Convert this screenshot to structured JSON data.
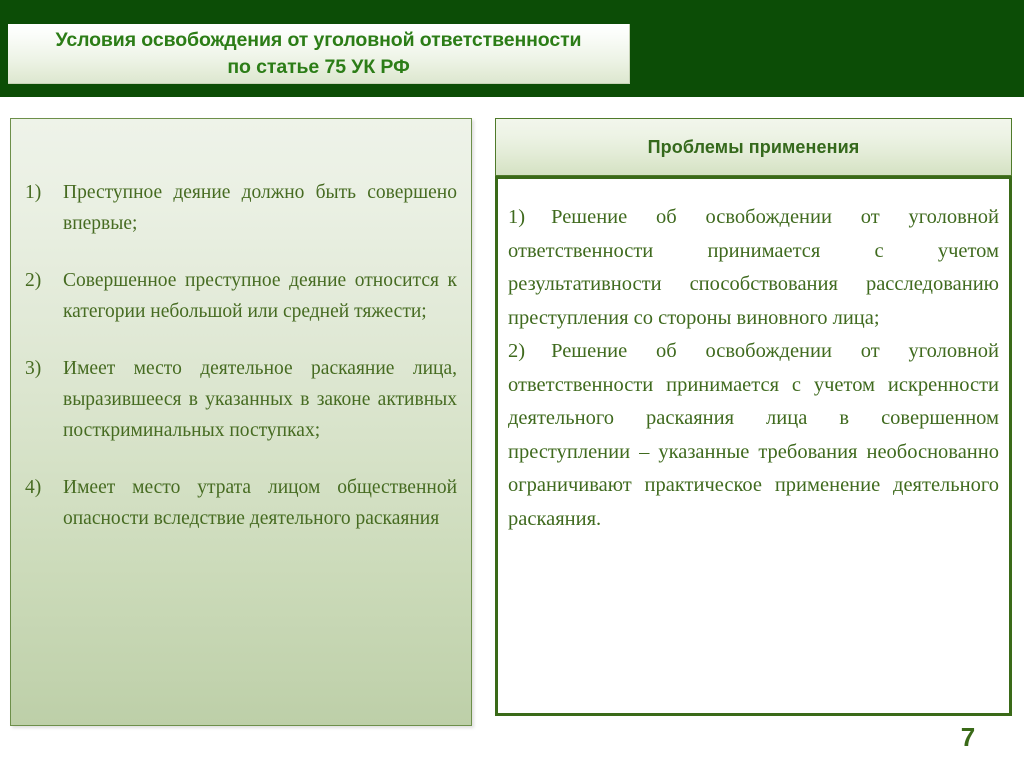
{
  "slide": {
    "page_number": "7",
    "banner_color": "#0c4d06",
    "accent_color": "#3a6a18",
    "text_color": "#466b21"
  },
  "header": {
    "title_line1": "Условия освобождения от уголовной ответственности",
    "title_line2": "по статье 75 УК РФ"
  },
  "left_panel": {
    "items": [
      {
        "marker": "1)",
        "text": "Преступное деяние должно быть совершено впервые;"
      },
      {
        "marker": "2)",
        "text": "Совершенное преступное деяние относится к категории небольшой или средней тяжести;"
      },
      {
        "marker": "3)",
        "text": "Имеет место деятельное раскаяние лица, выразившееся в  указанных в законе активных посткриминальных поступках;"
      },
      {
        "marker": "4)",
        "text": "Имеет место утрата лицом общественной опасности вследствие деятельного раскаяния"
      }
    ]
  },
  "right_panel": {
    "header": "Проблемы применения",
    "items": [
      {
        "marker": "1)",
        "text": "Решение об освобождении от уголовной ответственности принимается с учетом результативности способствования расследованию преступления со стороны виновного лица;"
      },
      {
        "marker": "2)",
        "text": "Решение об освобождении от уголовной ответственности принимается с учетом искренности деятельного раскаяния лица в совершенном преступлении – указанные требования необоснованно ограничивают практическое применение деятельного раскаяния."
      }
    ]
  }
}
